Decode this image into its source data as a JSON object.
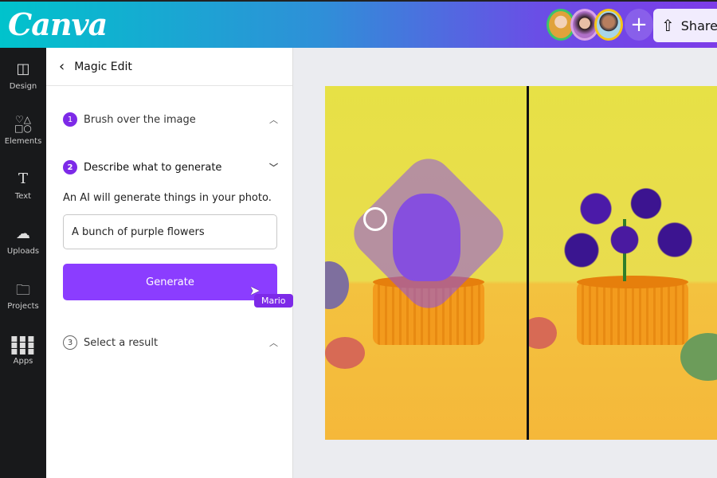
{
  "header": {
    "logo": "Canva",
    "share_label": "Share",
    "avatars": [
      "collaborator-1",
      "collaborator-2",
      "collaborator-3"
    ],
    "add_label": "+"
  },
  "sidebar": {
    "items": [
      {
        "label": "Design",
        "icon": "layout-icon"
      },
      {
        "label": "Elements",
        "icon": "shapes-icon"
      },
      {
        "label": "Text",
        "icon": "text-icon"
      },
      {
        "label": "Uploads",
        "icon": "cloud-upload-icon"
      },
      {
        "label": "Projects",
        "icon": "folder-icon"
      },
      {
        "label": "Apps",
        "icon": "grid-icon"
      }
    ]
  },
  "panel": {
    "title": "Magic Edit",
    "steps": [
      {
        "num": "1",
        "label": "Brush over the image"
      },
      {
        "num": "2",
        "label": "Describe what to generate"
      },
      {
        "num": "3",
        "label": "Select a result"
      }
    ],
    "description": "An AI will generate things in your photo.",
    "prompt_value": "A bunch of purple flowers",
    "generate_label": "Generate",
    "cursor_user": "Mario"
  },
  "colors": {
    "accent": "#8b3dff",
    "sidebar": "#18191b"
  }
}
